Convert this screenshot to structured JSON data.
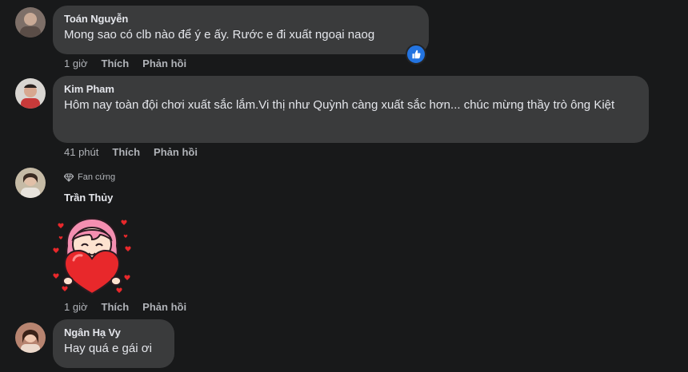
{
  "comments": [
    {
      "author": "Toán Nguyễn",
      "text": "Mong sao có clb nào để ý e ấy. Rước e đi xuất ngoại naog",
      "time": "1 giờ",
      "like": "Thích",
      "reply": "Phản hồi",
      "avatar_color": "#8a7a72",
      "reaction_icon": "thumbs-up-icon"
    },
    {
      "author": "Kim Pham",
      "text": "Hôm nay toàn đội chơi xuất sắc lắm.Vi thị như Quỳnh càng xuất sắc hơn... chúc mừng thầy trò ông Kiệt",
      "time": "41 phút",
      "like": "Thích",
      "reply": "Phản hồi",
      "avatar_color": "#c9c4bf"
    },
    {
      "badge": "Fan cứng",
      "badge_icon": "diamond-icon",
      "author": "Trần Thủy",
      "sticker": "heart-girl-sticker",
      "time": "1 giờ",
      "like": "Thích",
      "reply": "Phản hồi",
      "avatar_color": "#b3a48e"
    },
    {
      "author": "Ngân Hạ Vy",
      "text": "Hay quá e gái ơi",
      "avatar_color": "#c7937f"
    }
  ],
  "colors": {
    "background": "#18191a",
    "bubble": "#3a3b3c",
    "secondary_text": "#b0b3b8",
    "like_blue": "#2374e1",
    "heart_red": "#e8282b",
    "sticker_pink": "#f48fb1"
  }
}
